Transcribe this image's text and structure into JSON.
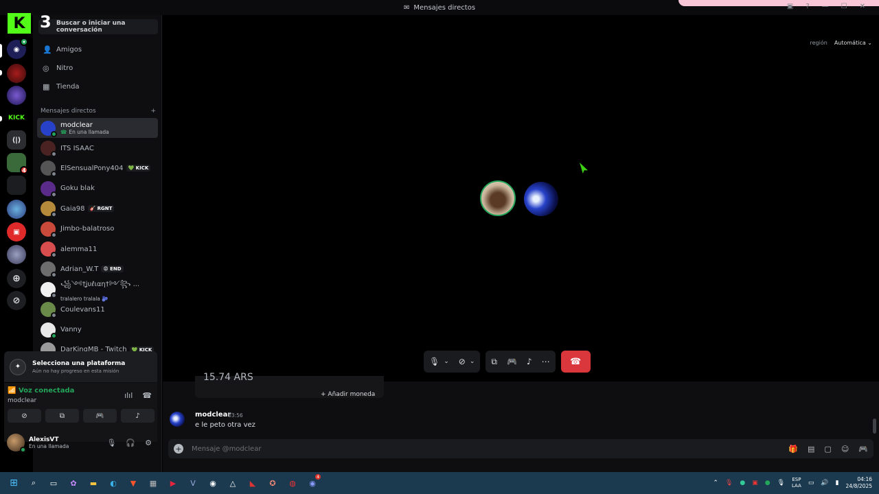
{
  "window": {
    "title": "Mensajes directos"
  },
  "rail": {
    "kick_label": "KICK",
    "mention_badge": "4"
  },
  "overlay": {
    "big_number": "3",
    "kick_logo_letter": "K"
  },
  "sidebar": {
    "search_label": "Buscar o iniciar una conversación",
    "nav": [
      {
        "label": "Amigos",
        "icon": "friends-icon"
      },
      {
        "label": "Nitro",
        "icon": "nitro-icon"
      },
      {
        "label": "Tienda",
        "icon": "shop-icon"
      }
    ],
    "dm_header": "Mensajes directos",
    "dm_add": "+",
    "dms": [
      {
        "name": "modclear",
        "sub": "En una llamada",
        "active": true,
        "status": "#23a55a",
        "avatar": "#2742c9"
      },
      {
        "name": "ITS ISAAC",
        "sub": "",
        "tag": "",
        "status": "#80848e",
        "avatar": "#4a2222"
      },
      {
        "name": "ElSensualPony404",
        "tag": "💚 KICK",
        "status": "#80848e",
        "avatar": "#555"
      },
      {
        "name": "Goku blak",
        "tag": "",
        "status": "#80848e",
        "avatar": "#5b2b8a"
      },
      {
        "name": "Gaia98",
        "tag": "🎸 RGNT",
        "status": "#80848e",
        "avatar": "#b58a3a"
      },
      {
        "name": "Jimbo-balatroso",
        "tag": "",
        "status": "#80848e",
        "avatar": "#c94a3a"
      },
      {
        "name": "alemma11",
        "tag": "",
        "status": "#80848e",
        "avatar": "#d84d4d"
      },
      {
        "name": "Adrian_W.T",
        "tag": "😡 END",
        "status": "#80848e",
        "avatar": "#6d6d6d"
      },
      {
        "name": "꧁༺†ʝυℓιαη†༻꧂ ...",
        "sub": "tralalero tralala 🫐",
        "tag": "",
        "status": "#80848e",
        "avatar": "#f0f0f0"
      },
      {
        "name": "Coulevans11",
        "tag": "",
        "status": "#80848e",
        "avatar": "#6a8a4a"
      },
      {
        "name": "Vanny",
        "tag": "",
        "status": "#23a55a",
        "avatar": "#e8e8e8"
      },
      {
        "name": "DarKingMB - Twitch",
        "tag": "💚 KICK",
        "status": "#80848e",
        "avatar": "#9a9a9a"
      }
    ]
  },
  "mission": {
    "title": "Selecciona una plataforma",
    "subtitle": "Aún no hay progreso en esta misión"
  },
  "voice": {
    "status": "Voz conectada",
    "channel": "modclear"
  },
  "user": {
    "name": "AlexisVT",
    "status": "En una llamada"
  },
  "call": {
    "region_label": "región",
    "region_value": "Automática"
  },
  "chat": {
    "coin_text": "15.74 ARS",
    "add_coin": "Añadir moneda",
    "message": {
      "author": "modclear",
      "time": "03:56",
      "text": "e le peto otra vez"
    },
    "composer_placeholder": "Mensaje @modclear"
  },
  "taskbar": {
    "lang_top": "ESP",
    "lang_bottom": "LAA",
    "time": "04:16",
    "date": "24/8/2025",
    "discord_badge": "4"
  },
  "colors": {
    "accent": "#5865f2",
    "online": "#23a55a",
    "danger": "#da373c",
    "kick": "#53fc18"
  }
}
